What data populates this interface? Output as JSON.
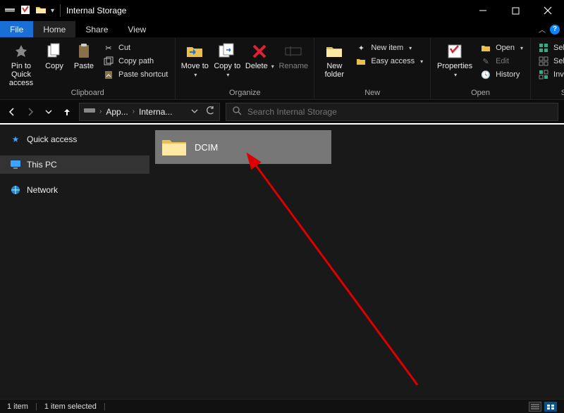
{
  "window": {
    "title": "Internal Storage"
  },
  "tabs": {
    "file": "File",
    "home": "Home",
    "share": "Share",
    "view": "View"
  },
  "ribbon": {
    "clipboard": {
      "label": "Clipboard",
      "pin": "Pin to Quick access",
      "copy": "Copy",
      "paste": "Paste",
      "cut": "Cut",
      "copy_path": "Copy path",
      "paste_shortcut": "Paste shortcut"
    },
    "organize": {
      "label": "Organize",
      "move_to": "Move to",
      "copy_to": "Copy to",
      "delete": "Delete",
      "rename": "Rename"
    },
    "new": {
      "label": "New",
      "new_folder": "New folder",
      "new_item": "New item",
      "easy_access": "Easy access"
    },
    "open": {
      "label": "Open",
      "properties": "Properties",
      "open": "Open",
      "edit": "Edit",
      "history": "History"
    },
    "select": {
      "label": "Select",
      "select_all": "Select all",
      "select_none": "Select none",
      "invert": "Invert selection"
    }
  },
  "breadcrumb": {
    "part1": "App...",
    "part2": "Interna..."
  },
  "search": {
    "placeholder": "Search Internal Storage"
  },
  "sidebar": {
    "quick_access": "Quick access",
    "this_pc": "This PC",
    "network": "Network"
  },
  "content": {
    "folder1": "DCIM"
  },
  "status": {
    "count": "1 item",
    "selected": "1 item selected"
  }
}
